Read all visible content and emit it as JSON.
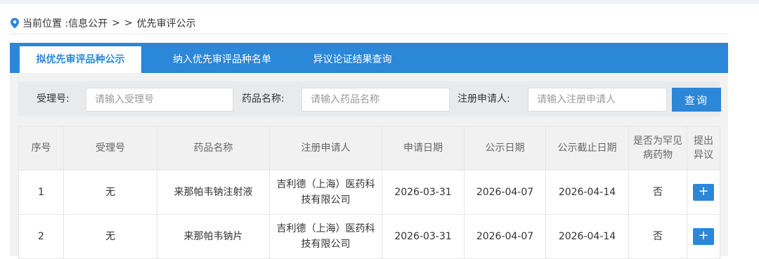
{
  "breadcrumb": {
    "label": "当前位置 : ",
    "items": [
      "信息公开",
      "优先审评公示"
    ],
    "separator": ">",
    "icon": "location-pin-icon"
  },
  "tabs": [
    {
      "label": "拟优先审评品种公示",
      "active": true
    },
    {
      "label": "纳入优先审评品种名单",
      "active": false
    },
    {
      "label": "异议论证结果查询",
      "active": false
    }
  ],
  "search": {
    "accept_label": "受理号:",
    "accept_placeholder": "请输入受理号",
    "drug_label": "药品名称:",
    "drug_placeholder": "请输入药品名称",
    "applicant_label": "注册申请人:",
    "applicant_placeholder": "请输入注册申请人",
    "query_button": "查询"
  },
  "table": {
    "headers": [
      "序号",
      "受理号",
      "药品名称",
      "注册申请人",
      "申请日期",
      "公示日期",
      "公示截止日期",
      "是否为罕见病药物",
      "提出异议"
    ],
    "rows": [
      [
        "1",
        "无",
        "来那帕韦钠注射液",
        "吉利德（上海）医药科技有限公司",
        "2026-03-31",
        "2026-04-07",
        "2026-04-14",
        "否",
        "+"
      ],
      [
        "2",
        "无",
        "来那帕韦钠片",
        "吉利德（上海）医药科技有限公司",
        "2026-03-31",
        "2026-04-07",
        "2026-04-14",
        "否",
        "+"
      ]
    ]
  },
  "colors": {
    "accent": "#2b87d8",
    "panel_bg": "#f2f2f2"
  }
}
